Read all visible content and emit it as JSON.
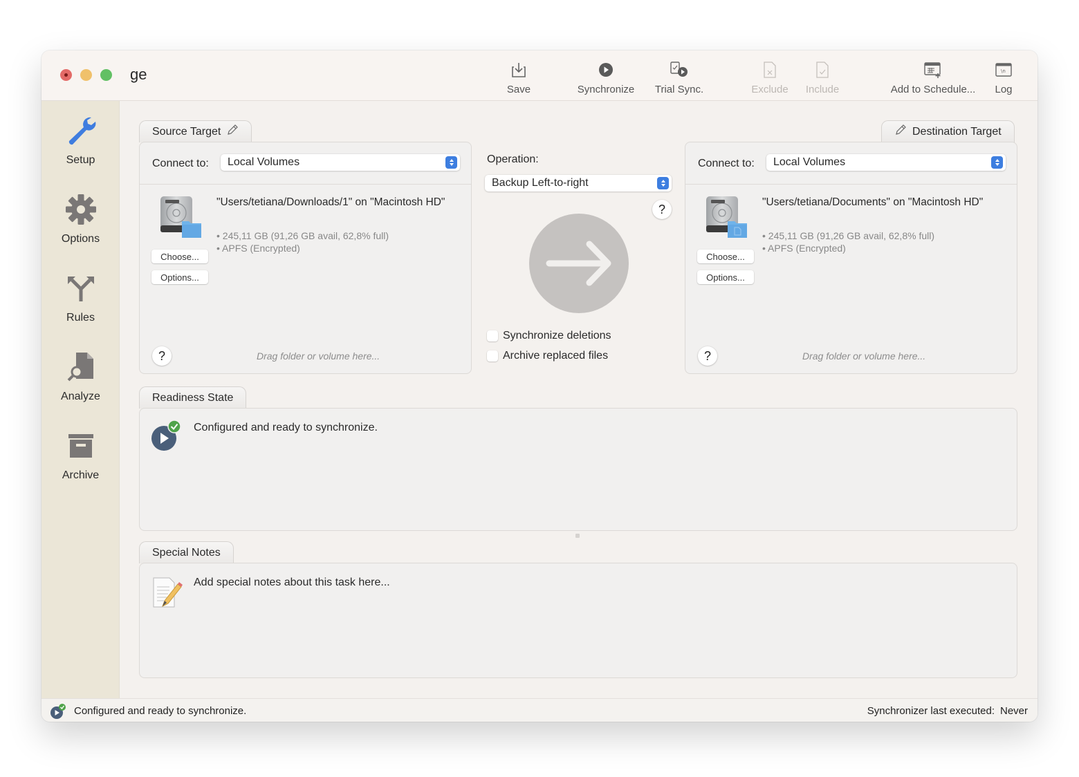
{
  "window": {
    "title": "ge"
  },
  "toolbar": {
    "items": [
      {
        "label": "Save",
        "icon": "save-icon",
        "enabled": true
      },
      {
        "label": "Synchronize",
        "icon": "play-circle-icon",
        "enabled": true
      },
      {
        "label": "Trial Sync.",
        "icon": "trial-sync-icon",
        "enabled": true
      },
      {
        "label": "Exclude",
        "icon": "exclude-file-icon",
        "enabled": false
      },
      {
        "label": "Include",
        "icon": "include-file-icon",
        "enabled": false
      },
      {
        "label": "Add to Schedule...",
        "icon": "schedule-icon",
        "enabled": true
      },
      {
        "label": "Log",
        "icon": "log-icon",
        "enabled": true
      }
    ]
  },
  "sidebar": {
    "items": [
      {
        "label": "Setup",
        "icon": "wrench-icon",
        "active": true
      },
      {
        "label": "Options",
        "icon": "gear-icon",
        "active": false
      },
      {
        "label": "Rules",
        "icon": "fork-arrows-icon",
        "active": false
      },
      {
        "label": "Analyze",
        "icon": "analyze-document-icon",
        "active": false
      },
      {
        "label": "Archive",
        "icon": "archive-box-icon",
        "active": false
      }
    ]
  },
  "source": {
    "tab_label": "Source Target",
    "connect_label": "Connect to:",
    "connect_value": "Local Volumes",
    "path": "\"Users/tetiana/Downloads/1\" on \"Macintosh HD\"",
    "capacity": "• 245,11 GB (91,26 GB avail, 62,8% full)",
    "format": "• APFS (Encrypted)",
    "choose_label": "Choose...",
    "options_label": "Options...",
    "help_label": "?",
    "drag_hint": "Drag folder or volume here..."
  },
  "operation": {
    "label": "Operation:",
    "value": "Backup Left-to-right",
    "help_label": "?",
    "checkboxes": [
      {
        "label": "Synchronize deletions",
        "checked": false
      },
      {
        "label": "Archive replaced files",
        "checked": false
      }
    ]
  },
  "destination": {
    "tab_label": "Destination Target",
    "connect_label": "Connect to:",
    "connect_value": "Local Volumes",
    "path": "\"Users/tetiana/Documents\" on \"Macintosh HD\"",
    "capacity": "• 245,11 GB (91,26 GB avail, 62,8% full)",
    "format": "• APFS (Encrypted)",
    "choose_label": "Choose...",
    "options_label": "Options...",
    "help_label": "?",
    "drag_hint": "Drag folder or volume here..."
  },
  "readiness": {
    "tab_label": "Readiness State",
    "message": "Configured and ready to synchronize."
  },
  "notes": {
    "tab_label": "Special Notes",
    "placeholder": "Add special notes about this task here..."
  },
  "statusbar": {
    "message": "Configured and ready to synchronize.",
    "last_executed_label": "Synchronizer last executed:",
    "last_executed_value": "Never"
  },
  "colors": {
    "accent": "#3d7ee0",
    "sidebar_bg": "#ebe6d7",
    "success": "#4fa34a"
  }
}
